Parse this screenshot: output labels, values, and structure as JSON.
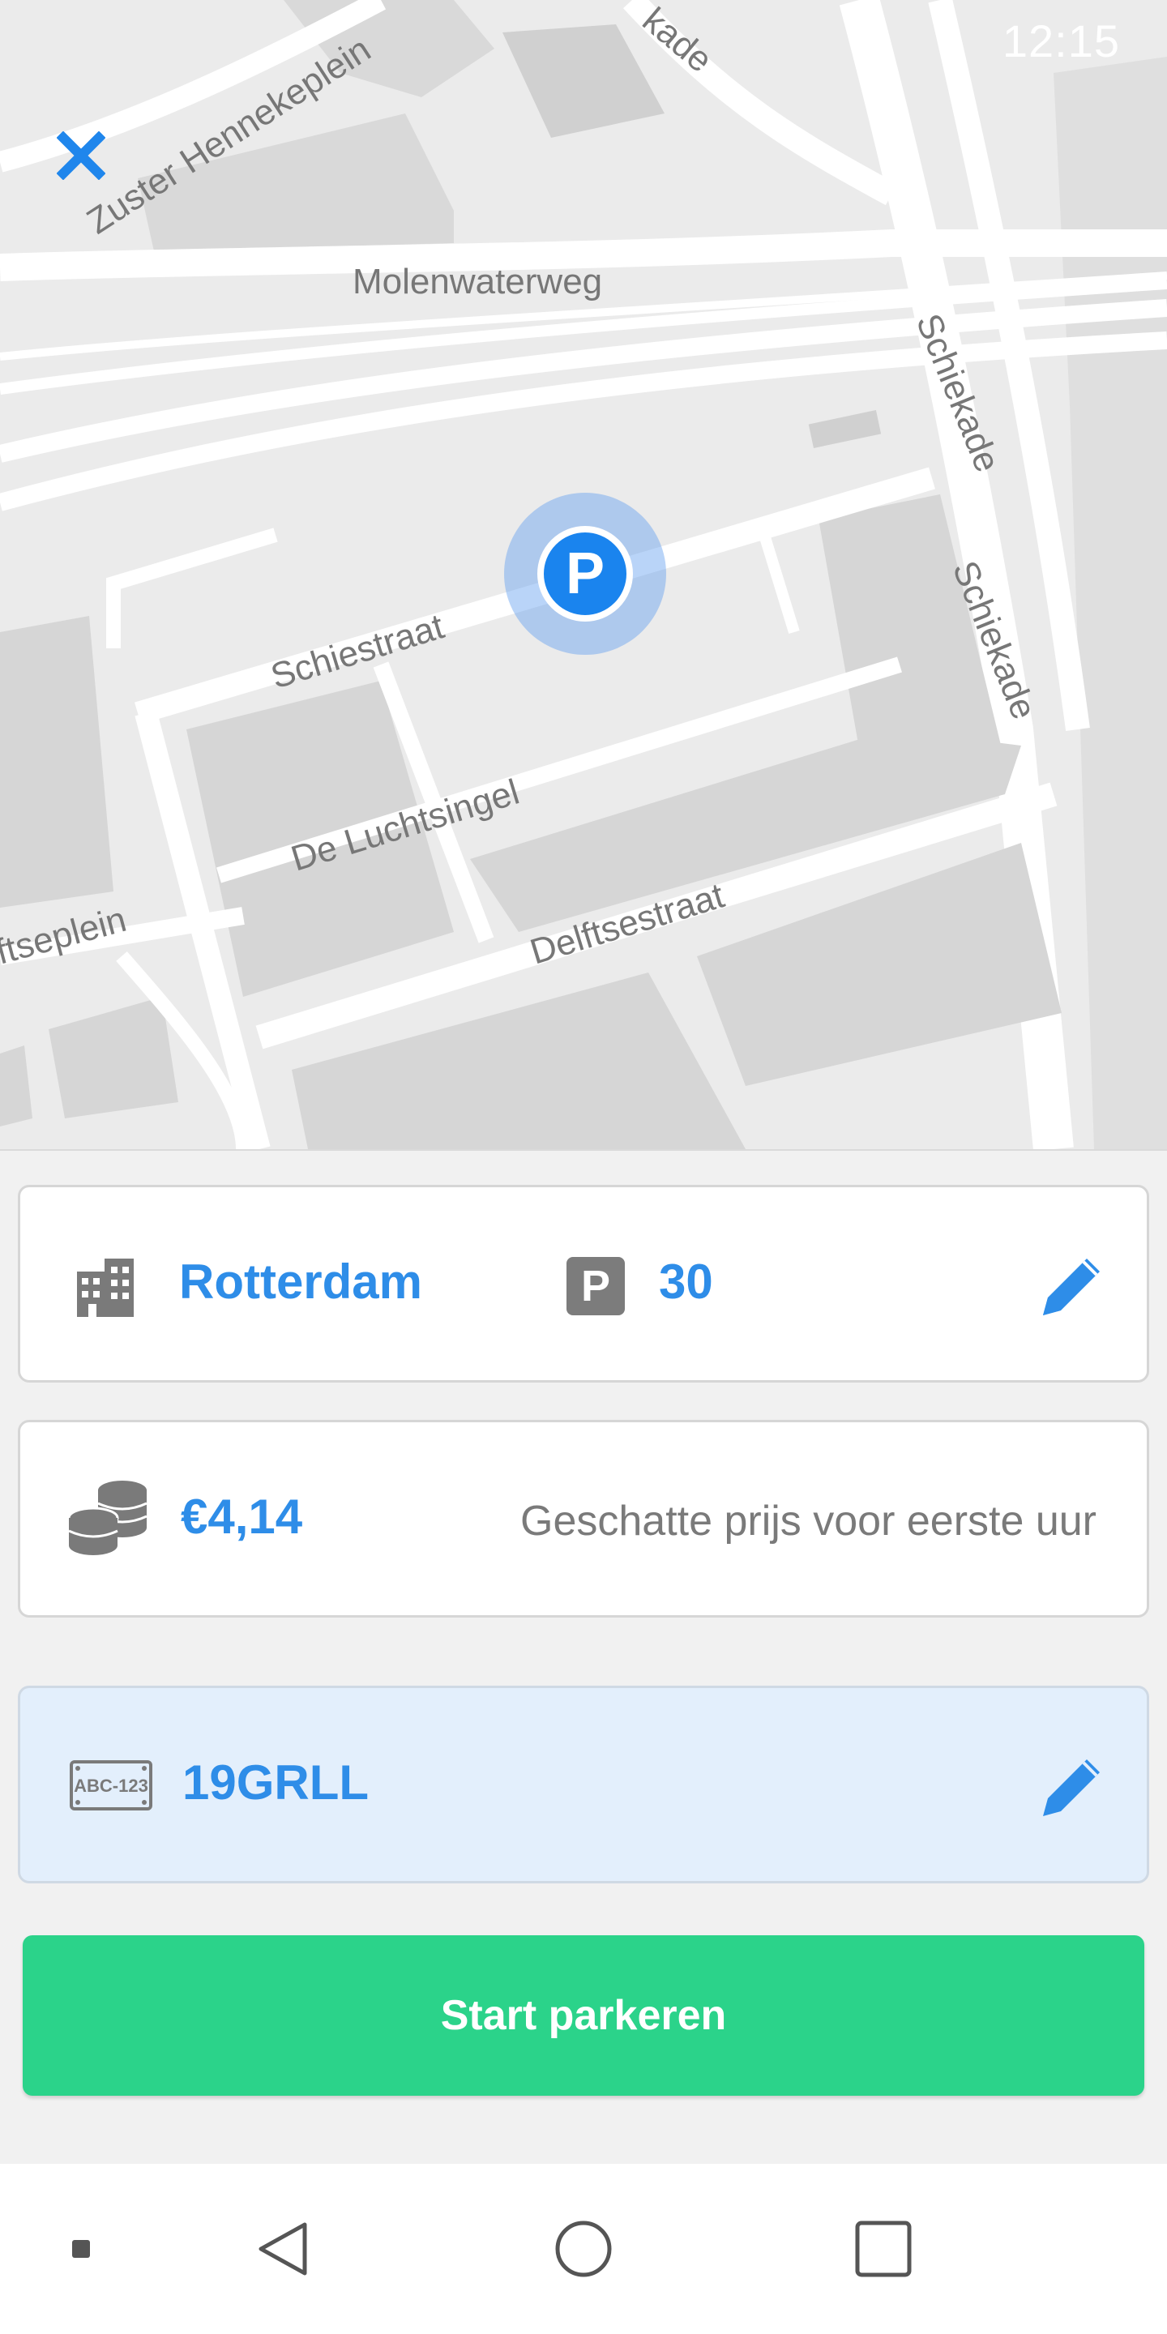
{
  "status_bar": {
    "time": "12:15"
  },
  "map": {
    "streets": [
      {
        "id": "zuster",
        "label": "Zuster Hennekeplein"
      },
      {
        "id": "kade-top",
        "label": "kade"
      },
      {
        "id": "molenwaterweg",
        "label": "Molenwaterweg"
      },
      {
        "id": "schiekade1",
        "label": "Schiekade"
      },
      {
        "id": "schiekade2",
        "label": "Schiekade"
      },
      {
        "id": "schiestraat",
        "label": "Schiestraat"
      },
      {
        "id": "luchtsingel",
        "label": "De Luchtsingel"
      },
      {
        "id": "delftseplein",
        "label": "ftseplein"
      },
      {
        "id": "delftsestraat",
        "label": "Delftsestraat"
      }
    ],
    "pin_label": "P"
  },
  "location": {
    "city": "Rotterdam",
    "zone_badge": "P",
    "zone": "30"
  },
  "price": {
    "amount": "€4,14",
    "note": "Geschatte prijs voor eerste uur"
  },
  "vehicle": {
    "plate_icon_text": "ABC-123",
    "plate": "19GRLL"
  },
  "actions": {
    "start_label": "Start parkeren"
  },
  "colors": {
    "accent": "#2e8de8",
    "start_button": "#2bd38a",
    "plate_card": "#e3effc"
  }
}
